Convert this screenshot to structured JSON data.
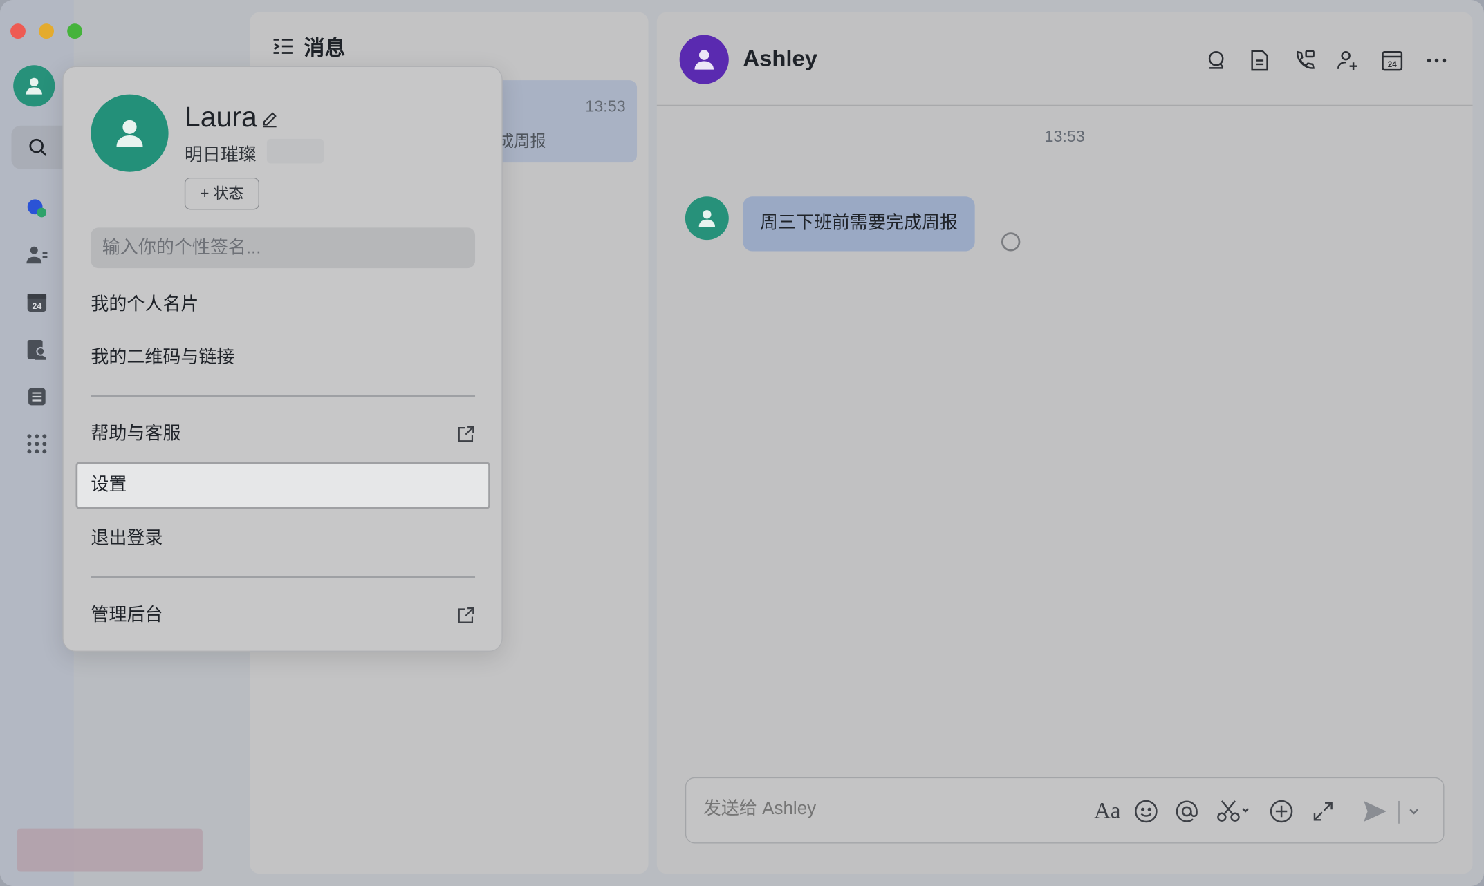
{
  "window": {
    "traffic_lights": {
      "close": "#ee5b53",
      "minimize": "#e4ab2e",
      "maximize": "#45b33b"
    }
  },
  "list_panel": {
    "title": "消息",
    "item": {
      "time": "13:53",
      "preview": "成周报"
    }
  },
  "chat": {
    "contact_name": "Ashley",
    "timestamp": "13:53",
    "message": "周三下班前需要完成周报",
    "composer_placeholder": "发送给 Ashley",
    "format_label": "Aa"
  },
  "profile_popup": {
    "name": "Laura",
    "org": "明日璀璨",
    "status_button": "+ 状态",
    "signature_placeholder": "输入你的个性签名...",
    "menu": {
      "card": "我的个人名片",
      "qrcode": "我的二维码与链接",
      "help": "帮助与客服",
      "settings": "设置",
      "logout": "退出登录",
      "admin": "管理后台"
    }
  },
  "colors": {
    "avatar_green": "#27917a",
    "avatar_purple": "#5a2ab0",
    "bubble": "#9aa9c4",
    "highlight": "#e6e7e8"
  }
}
